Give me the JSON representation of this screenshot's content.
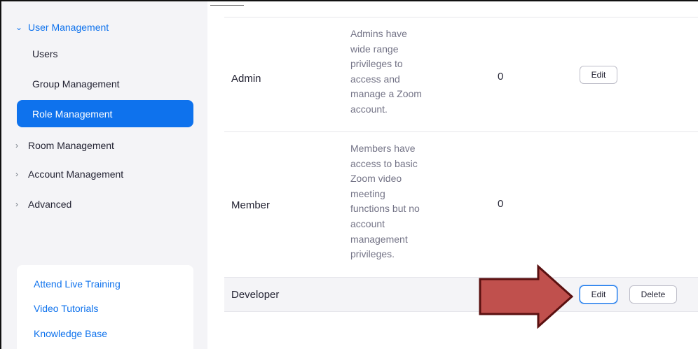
{
  "sidebar": {
    "user_management": {
      "label": "User Management",
      "chevron": "chevron-down-icon"
    },
    "users": "Users",
    "group_management": "Group Management",
    "role_management": "Role Management",
    "room_management": {
      "label": "Room Management",
      "chevron": "chevron-right-icon"
    },
    "account_management": {
      "label": "Account Management",
      "chevron": "chevron-right-icon"
    },
    "advanced": {
      "label": "Advanced",
      "chevron": "chevron-right-icon"
    },
    "help": {
      "attend_live_training": "Attend Live Training",
      "video_tutorials": "Video Tutorials",
      "knowledge_base": "Knowledge Base"
    }
  },
  "roles": [
    {
      "name": "Admin",
      "description_lines": [
        "Admins have",
        "wide range",
        "privileges to",
        "access and",
        "manage a Zoom",
        "account."
      ],
      "count": "0",
      "edit_label": "Edit"
    },
    {
      "name": "Member",
      "description_lines": [
        "Members have",
        "access to basic",
        "Zoom video",
        "meeting",
        "functions but no",
        "account",
        "management",
        "privileges."
      ],
      "count": "0"
    },
    {
      "name": "Developer",
      "edit_label": "Edit",
      "delete_label": "Delete"
    }
  ],
  "colors": {
    "accent": "#0e72ed",
    "sidebar_bg": "#f4f4f7",
    "arrow_fill": "#c0504d",
    "arrow_stroke": "#5a1010"
  },
  "annotation": {
    "icon": "red-arrow-icon",
    "points_to": "Developer Edit button"
  }
}
